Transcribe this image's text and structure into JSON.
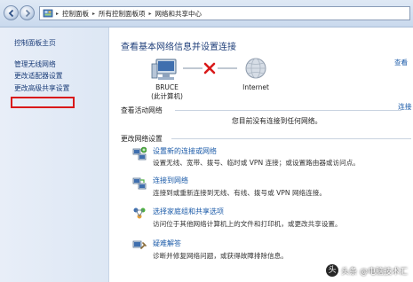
{
  "address_bar": {
    "segments": [
      "控制面板",
      "所有控制面板项",
      "网络和共享中心"
    ]
  },
  "sidebar": {
    "items": [
      {
        "label": "控制面板主页"
      },
      {
        "label": "管理无线网络"
      },
      {
        "label": "更改适配器设置",
        "highlighted": true
      },
      {
        "label": "更改高级共享设置"
      }
    ],
    "highlight_color": "#d9191a"
  },
  "main": {
    "title": "查看基本网络信息并设置连接",
    "view_full_map_link": "查看",
    "network_map": {
      "computer_name": "BRUCE",
      "computer_sub": "(此计算机)",
      "internet_label": "Internet",
      "status": "disconnected"
    },
    "active_networks": {
      "label": "查看活动网络",
      "status_text": "您目前没有连接到任何网络。",
      "link": "连接"
    },
    "change_settings": {
      "label": "更改网络设置",
      "tasks": [
        {
          "icon": "network-setup-icon",
          "title": "设置新的连接或网络",
          "desc": "设置无线、宽带、拨号、临时或 VPN 连接；或设置路由器或访问点。"
        },
        {
          "icon": "connect-network-icon",
          "title": "连接到网络",
          "desc": "连接到或重新连接到无线、有线、拨号或 VPN 网络连接。"
        },
        {
          "icon": "homegroup-icon",
          "title": "选择家庭组和共享选项",
          "desc": "访问位于其他网络计算机上的文件和打印机，或更改共享设置。"
        },
        {
          "icon": "troubleshoot-icon",
          "title": "疑难解答",
          "desc": "诊断并修复网络问题，或获得故障排除信息。"
        }
      ]
    }
  },
  "watermark": {
    "text": "头条 @电脑技术汇"
  },
  "colors": {
    "link": "#1a5aa8",
    "title": "#1f3f7a",
    "error_x": "#d9191a"
  }
}
